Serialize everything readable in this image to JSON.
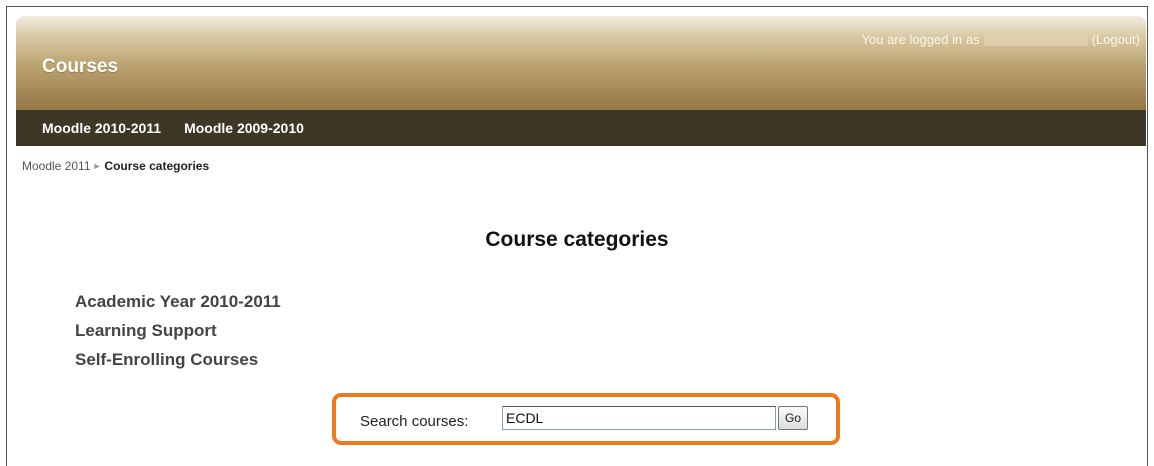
{
  "header": {
    "site_title": "Courses",
    "login_prefix": "You are logged in as",
    "logout_label": "(Logout)"
  },
  "nav": {
    "items": [
      {
        "label": "Moodle 2010-2011"
      },
      {
        "label": "Moodle 2009-2010"
      }
    ]
  },
  "breadcrumb": {
    "home": "Moodle 2011",
    "separator": "►",
    "current": "Course categories"
  },
  "main": {
    "title": "Course categories",
    "categories": [
      {
        "label": "Academic Year 2010-2011"
      },
      {
        "label": "Learning Support"
      },
      {
        "label": "Self-Enrolling Courses"
      }
    ]
  },
  "search": {
    "label": "Search courses:",
    "value": "ECDL",
    "button_label": "Go"
  },
  "colors": {
    "header_gradient_top": "#f1ece0",
    "header_gradient_bottom": "#947845",
    "navbar_bg": "#3e3726",
    "highlight": "#ec7a1e"
  }
}
